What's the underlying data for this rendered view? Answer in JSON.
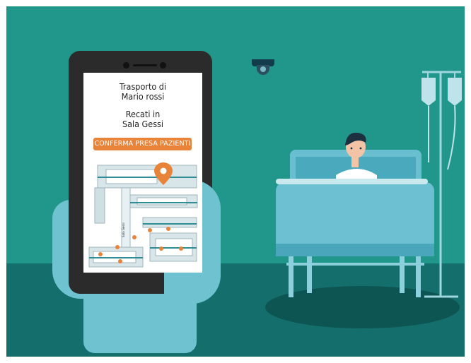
{
  "phone": {
    "title_line1": "Trasporto di",
    "title_line2": "Mario rossi",
    "instruction_line1": "Recati in",
    "instruction_line2": "Sala Gessi",
    "confirm_button": "CONFERMA PRESA PAZIENTI",
    "map_labels": [
      "Sala Gessi"
    ]
  },
  "colors": {
    "wall": "#20978a",
    "floor": "#136e6c",
    "accent": "#e8833a",
    "hand": "#6fc2d0"
  },
  "icons": {
    "pin": "location-pin-icon",
    "camera": "security-camera-icon",
    "iv": "iv-drip-icon"
  }
}
